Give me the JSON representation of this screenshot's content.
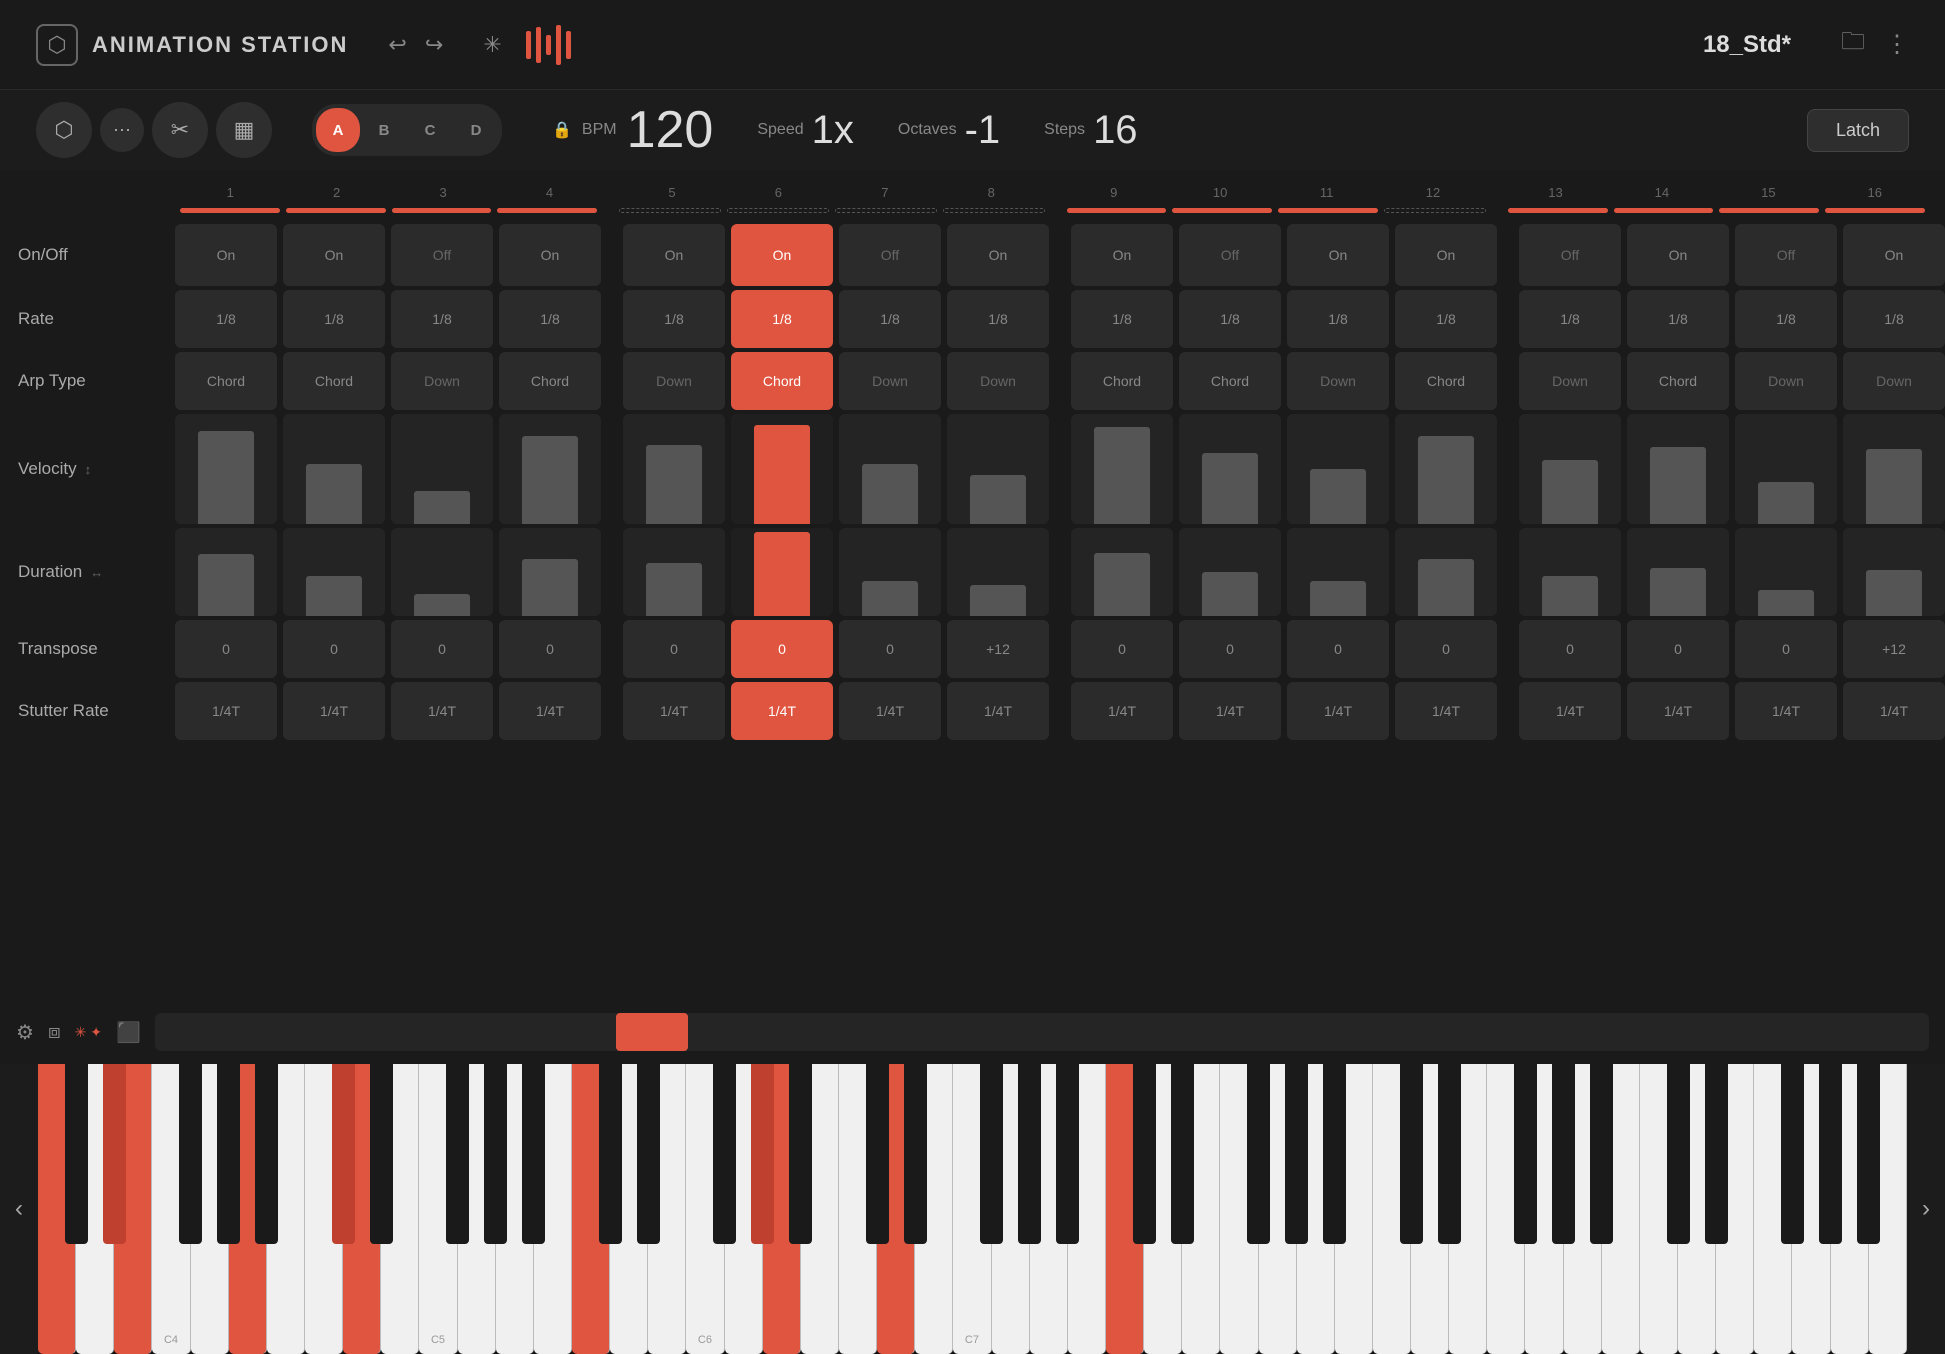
{
  "header": {
    "title": "ANIMATION STATION",
    "preset": "18_Std*",
    "undo_label": "↩",
    "redo_label": "↪",
    "more_label": "⋮"
  },
  "controls": {
    "bpm_label": "BPM",
    "bpm_value": "120",
    "speed_label": "Speed",
    "speed_value": "1x",
    "octaves_label": "Octaves",
    "octaves_value": "-1",
    "steps_label": "Steps",
    "steps_value": "16",
    "latch_label": "Latch",
    "patterns": [
      "A",
      "B",
      "C",
      "D"
    ],
    "active_pattern": 0
  },
  "sequencer": {
    "row_labels": [
      "On/Off",
      "Rate",
      "Arp Type",
      "Velocity",
      "Duration",
      "Transpose",
      "Stutter Rate"
    ],
    "steps": 16,
    "active_step": 6,
    "on_off": [
      "On",
      "On",
      "Off",
      "On",
      "On",
      "On",
      "Off",
      "On",
      "On",
      "Off",
      "On",
      "On",
      "Off",
      "On",
      "Off",
      "On"
    ],
    "rate": [
      "1/8",
      "1/8",
      "1/8",
      "1/8",
      "1/8",
      "1/8",
      "1/8",
      "1/8",
      "1/8",
      "1/8",
      "1/8",
      "1/8",
      "1/8",
      "1/8",
      "1/8",
      "1/8"
    ],
    "arp_type": [
      "Chord",
      "Chord",
      "Down",
      "Chord",
      "Down",
      "Chord",
      "Down",
      "Down",
      "Chord",
      "Chord",
      "Down",
      "Chord",
      "Down",
      "Chord",
      "Down",
      "Down"
    ],
    "velocity": [
      85,
      55,
      30,
      80,
      72,
      90,
      55,
      45,
      88,
      65,
      50,
      80,
      58,
      70,
      38,
      68
    ],
    "duration": [
      70,
      45,
      25,
      65,
      60,
      95,
      40,
      35,
      72,
      50,
      40,
      65,
      45,
      55,
      30,
      52
    ],
    "transpose": [
      "0",
      "0",
      "0",
      "0",
      "0",
      "0",
      "0",
      "+12",
      "0",
      "0",
      "0",
      "0",
      "0",
      "0",
      "0",
      "+12"
    ],
    "stutter_rate": [
      "1/4T",
      "1/4T",
      "1/4T",
      "1/4T",
      "1/4T",
      "1/4T",
      "1/4T",
      "1/4T",
      "1/4T",
      "1/4T",
      "1/4T",
      "1/4T",
      "1/4T",
      "1/4T",
      "1/4T",
      "1/4T"
    ],
    "indicators": [
      true,
      true,
      true,
      true,
      false,
      false,
      false,
      false,
      true,
      true,
      true,
      false,
      true,
      true,
      true,
      true
    ]
  },
  "piano": {
    "left_nav": "‹",
    "right_nav": "›",
    "note_labels": [
      "C4",
      "C5",
      "C6",
      "C7"
    ],
    "highlighted_whites": [
      0,
      2,
      5,
      8,
      14,
      19,
      22
    ]
  }
}
